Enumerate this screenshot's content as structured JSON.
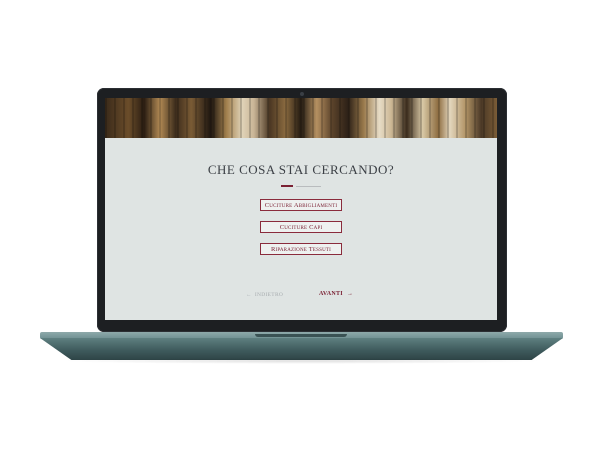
{
  "page": {
    "title": "CHE COSA STAI CERCANDO?",
    "options": [
      {
        "label": "Cuciture Abbigliamenti"
      },
      {
        "label": "Cuciture Capi"
      },
      {
        "label": "Riparazione Tessuti"
      }
    ],
    "nav": {
      "back_label": "INDIETRO",
      "next_label": "AVANTI",
      "back_arrow": "←",
      "next_arrow": "→"
    }
  },
  "colors": {
    "accent": "#7a2033",
    "background": "#dfe4e3",
    "laptop_base": "#3f5b5d"
  }
}
